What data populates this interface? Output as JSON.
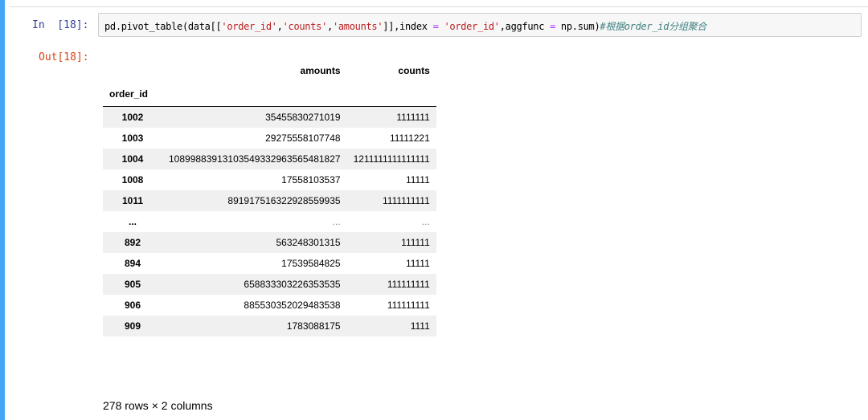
{
  "input_cell": {
    "prompt": "In  [18]:",
    "code_tokens": [
      {
        "text": "pd.pivot_table(data[[",
        "kind": "plain"
      },
      {
        "text": "'order_id'",
        "kind": "string"
      },
      {
        "text": ",",
        "kind": "plain"
      },
      {
        "text": "'counts'",
        "kind": "string"
      },
      {
        "text": ",",
        "kind": "plain"
      },
      {
        "text": "'amounts'",
        "kind": "string"
      },
      {
        "text": "]],index ",
        "kind": "plain"
      },
      {
        "text": "=",
        "kind": "operator"
      },
      {
        "text": " ",
        "kind": "plain"
      },
      {
        "text": "'order_id'",
        "kind": "string"
      },
      {
        "text": ",aggfunc ",
        "kind": "plain"
      },
      {
        "text": "=",
        "kind": "operator"
      },
      {
        "text": " np.sum)",
        "kind": "plain"
      },
      {
        "text": "#根据order_id分组聚合",
        "kind": "comment"
      }
    ]
  },
  "output_cell": {
    "prompt": "Out[18]:",
    "table": {
      "columns": [
        "amounts",
        "counts"
      ],
      "index_name": "order_id",
      "rows": [
        {
          "index": "1002",
          "amounts": "35455830271019",
          "counts": "1111111"
        },
        {
          "index": "1003",
          "amounts": "29275558107748",
          "counts": "11111221"
        },
        {
          "index": "1004",
          "amounts": "10899883913103549332963565481827",
          "counts": "1211111111111111"
        },
        {
          "index": "1008",
          "amounts": "17558103537",
          "counts": "11111"
        },
        {
          "index": "1011",
          "amounts": "891917516322928559935",
          "counts": "1111111111"
        },
        {
          "index": "...",
          "amounts": "...",
          "counts": "..."
        },
        {
          "index": "892",
          "amounts": "563248301315",
          "counts": "111111"
        },
        {
          "index": "894",
          "amounts": "17539584825",
          "counts": "11111"
        },
        {
          "index": "905",
          "amounts": "658833303226353535",
          "counts": "111111111"
        },
        {
          "index": "906",
          "amounts": "885530352029483538",
          "counts": "111111111"
        },
        {
          "index": "909",
          "amounts": "1783088175",
          "counts": "1111"
        }
      ]
    },
    "shape_note": "278 rows × 2 columns"
  },
  "colors": {
    "cell_selected_bar": "#42a5f5",
    "in_prompt": "#303f9f",
    "out_prompt": "#d84315",
    "string_literal": "#ba2121",
    "operator": "#aa22ff",
    "comment": "#408080",
    "code_background": "#f7f7f7",
    "row_stripe": "#f0f0f0"
  }
}
